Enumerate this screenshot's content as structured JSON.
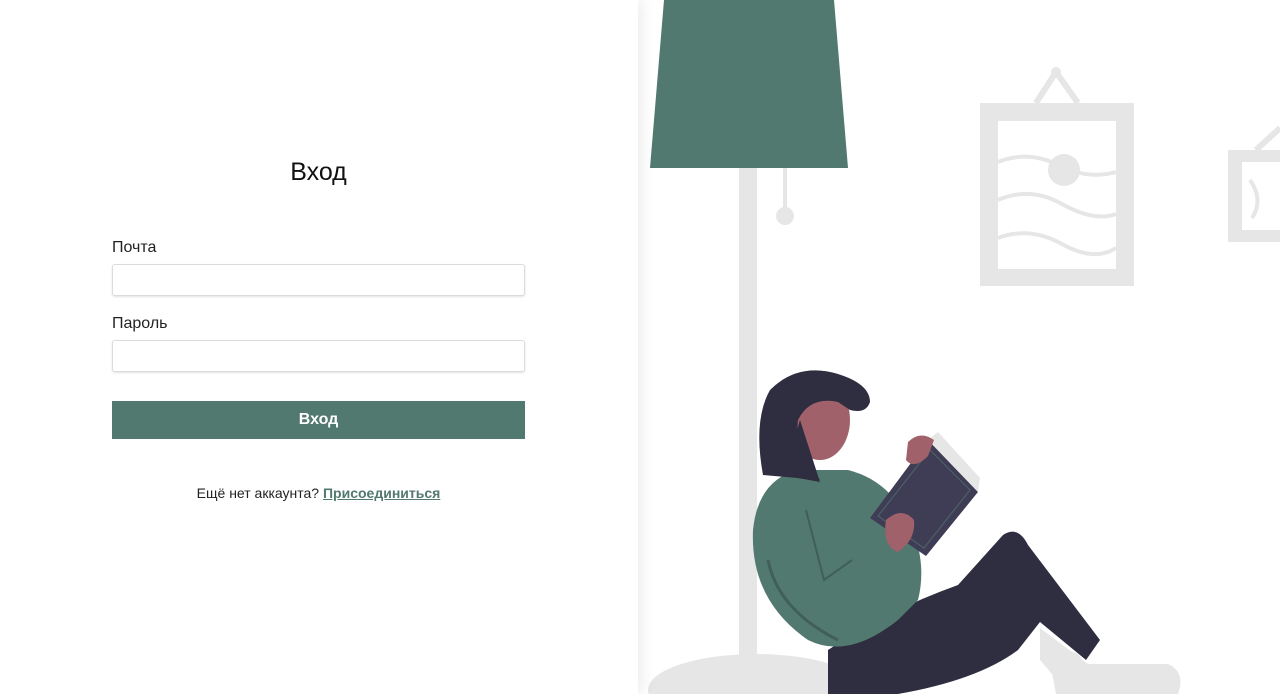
{
  "login": {
    "title": "Вход",
    "email_label": "Почта",
    "email_value": "",
    "password_label": "Пароль",
    "password_value": "",
    "submit_label": "Вход",
    "no_account_text": "Ещё нет аккаунта?",
    "join_link": "Присоединиться"
  },
  "illustration": {
    "icon": "woman-reading-under-lamp-illustration",
    "colors": {
      "accent": "#52796f",
      "dark": "#2f2e41",
      "skin": "#a0616a",
      "light_gray": "#e6e6e6"
    }
  },
  "colors": {
    "button_bg": "#52796f",
    "link": "#52796f"
  }
}
